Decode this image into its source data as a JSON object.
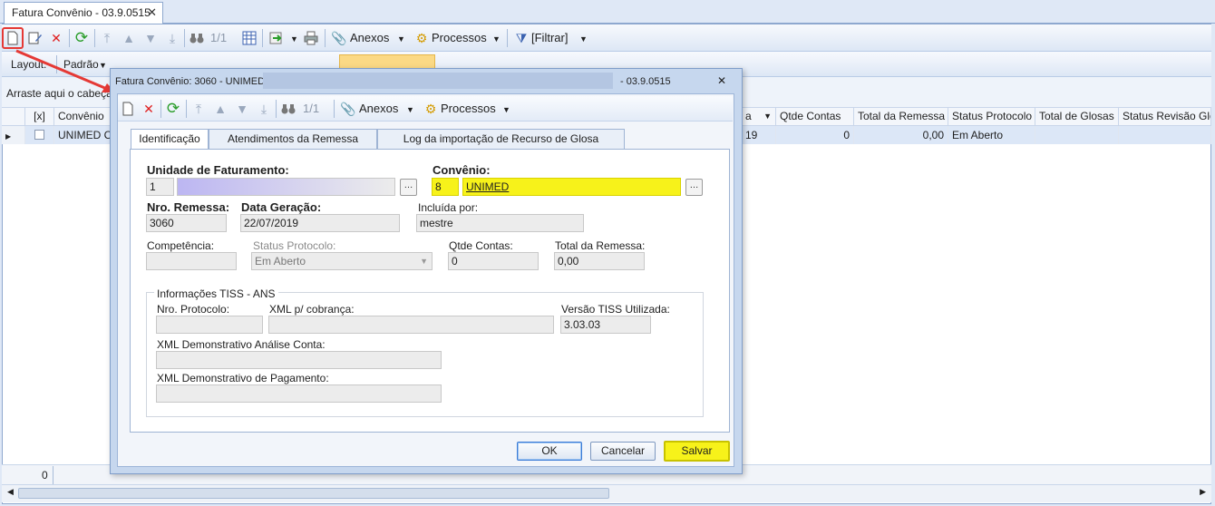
{
  "tab": {
    "title": "Fatura Convênio - 03.9.0515",
    "close": "✕"
  },
  "toolbar": {
    "record_nav": "1/1",
    "anexos": "Anexos",
    "processos": "Processos",
    "filtrar": "[Filtrar]"
  },
  "layoutbar": {
    "layout_label": "Layout:",
    "padrao": "Padrão"
  },
  "groupbar": {
    "hint": "Arraste aqui o cabeçalho"
  },
  "grid": {
    "headers": [
      "[x]",
      "Convênio",
      "a",
      "Qtde Contas",
      "Total da Remessa",
      "Status Protocolo",
      "Total de Glosas",
      "Status Revisão Glosa"
    ],
    "row": {
      "convenio": "UNIMED CO",
      "a": "19",
      "qtde": "0",
      "total": "0,00",
      "status": "Em Aberto"
    }
  },
  "statusbar": {
    "count": "0"
  },
  "dialog": {
    "title_prefix": "Fatura Convênio: 3060 - UNIMED",
    "title_suffix": "- 03.9.0515",
    "close": "✕",
    "record_nav": "1/1",
    "anexos": "Anexos",
    "processos": "Processos",
    "tabs": [
      "Identificação",
      "Atendimentos da Remessa",
      "Log da importação de Recurso de Glosa"
    ],
    "fields": {
      "unidade_label": "Unidade de Faturamento:",
      "unidade_code": "1",
      "convenio_label": "Convênio:",
      "convenio_code": "8",
      "convenio_name": "UNIMED",
      "nro_remessa_label": "Nro. Remessa:",
      "nro_remessa": "3060",
      "data_geracao_label": "Data Geração:",
      "data_geracao": "22/07/2019",
      "incluida_label": "Incluída por:",
      "incluida": "mestre",
      "competencia_label": "Competência:",
      "status_protocolo_label": "Status Protocolo:",
      "status_protocolo": "Em Aberto",
      "qtde_contas_label": "Qtde Contas:",
      "qtde_contas": "0",
      "total_remessa_label": "Total da Remessa:",
      "total_remessa": "0,00"
    },
    "tiss": {
      "legend": "Informações TISS - ANS",
      "nro_protocolo_label": "Nro. Protocolo:",
      "xml_cobranca_label": "XML p/ cobrança:",
      "versao_label": "Versão TISS Utilizada:",
      "versao": "3.03.03",
      "xml_analise_label": "XML Demonstrativo Análise Conta:",
      "xml_pagamento_label": "XML Demonstrativo de Pagamento:"
    },
    "buttons": {
      "ok": "OK",
      "cancel": "Cancelar",
      "save": "Salvar"
    }
  },
  "colors": {
    "highlight": "#f7f21a",
    "annotation": "#e53935",
    "accent": "#7f9dc9"
  }
}
